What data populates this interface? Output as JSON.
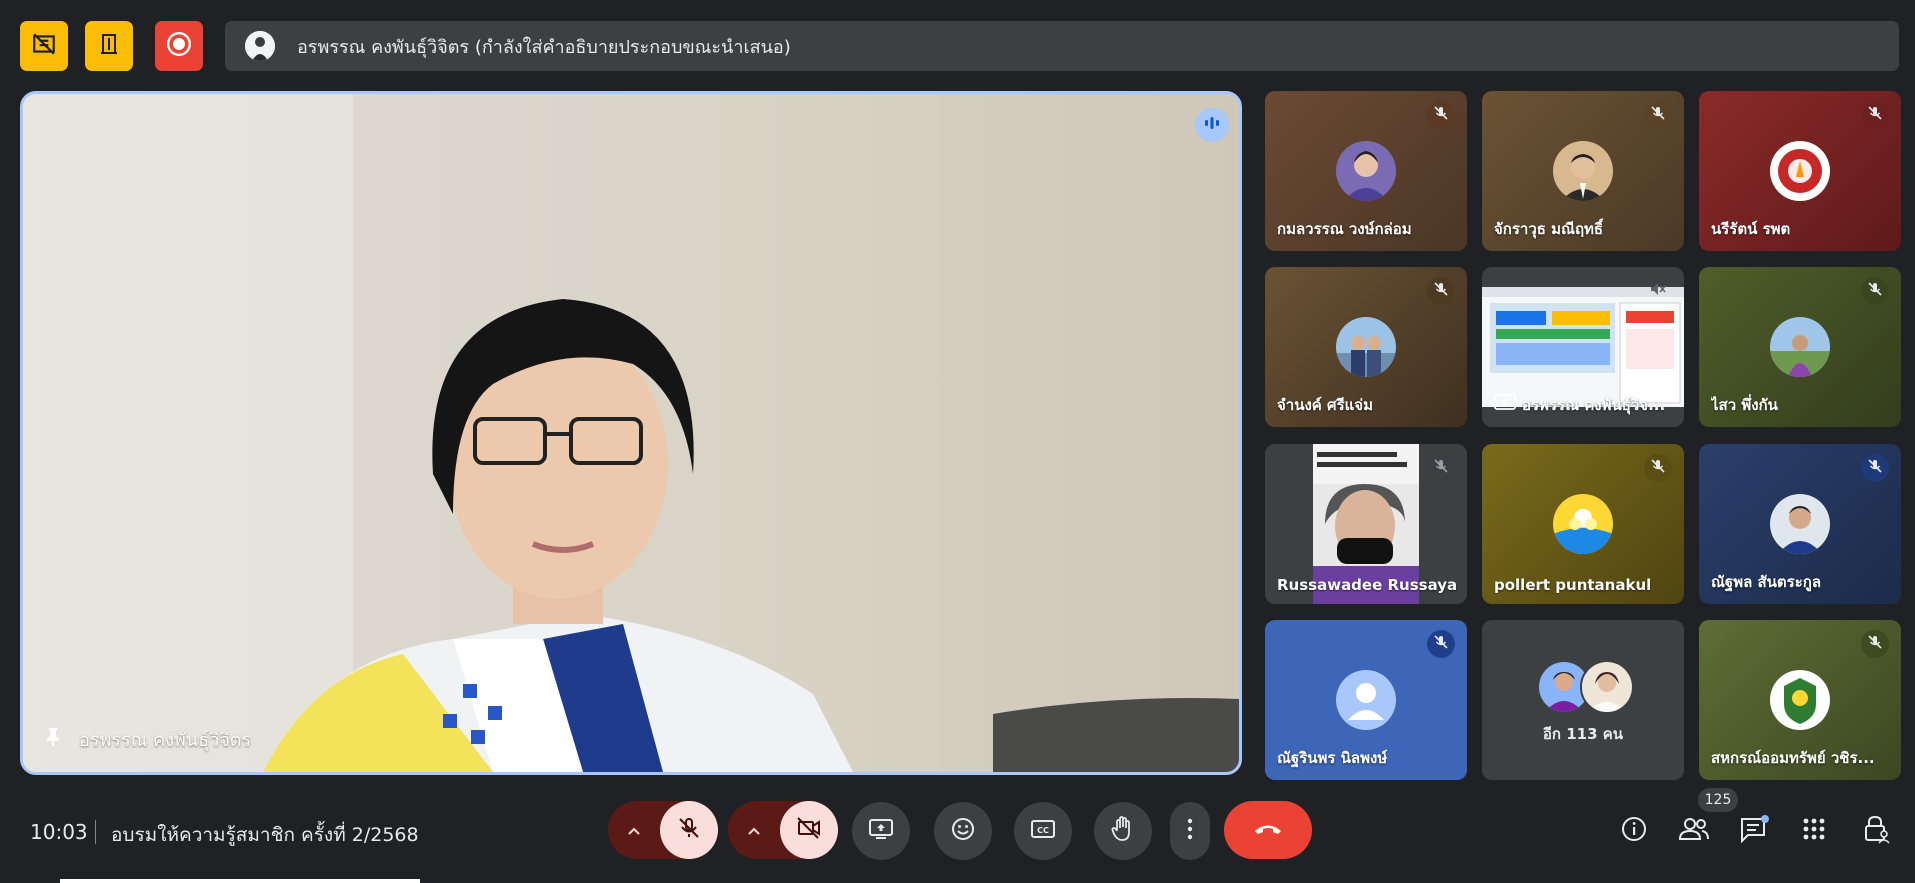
{
  "presenter": {
    "caption": "อรพรรณ คงพันธุ์วิจิตร (กำลังใส่คำอธิบายประกอบขณะนำเสนอ)"
  },
  "main_video": {
    "name": "อรพรรณ คงพันธุ์วิจิตร"
  },
  "tiles": [
    {
      "name": "กมลวรรณ วงษ์กล่อม"
    },
    {
      "name": "จักราวุธ มณีฤทธิ์"
    },
    {
      "name": "นรีรัตน์ รพต"
    },
    {
      "name": "จำนงค์ ศรีแจ่ม"
    },
    {
      "name": "อรพรรณ คงพันธุ์วิจ..."
    },
    {
      "name": "ไสว พึ่งกัน"
    },
    {
      "name": "Russawadee Russaya..."
    },
    {
      "name": "pollert puntanakul"
    },
    {
      "name": "ณัฐพล สันตระกูล"
    },
    {
      "name": "ณัฐรินพร นิลพงษ์"
    },
    {
      "name": "อีก 113 คน"
    },
    {
      "name": "สหกรณ์ออมทรัพย์ วชิร..."
    }
  ],
  "bottom": {
    "time": "10:03",
    "meeting_title": "อบรมให้ความรู้สมาชิก ครั้งที่ 2/2568",
    "participant_count": "125"
  },
  "colors": {
    "background": "#202124",
    "accent_yellow": "#fbbc04",
    "record_red": "#ea4335",
    "hangup_red": "#ea4335",
    "speaking_blue": "#a8c7fa"
  }
}
